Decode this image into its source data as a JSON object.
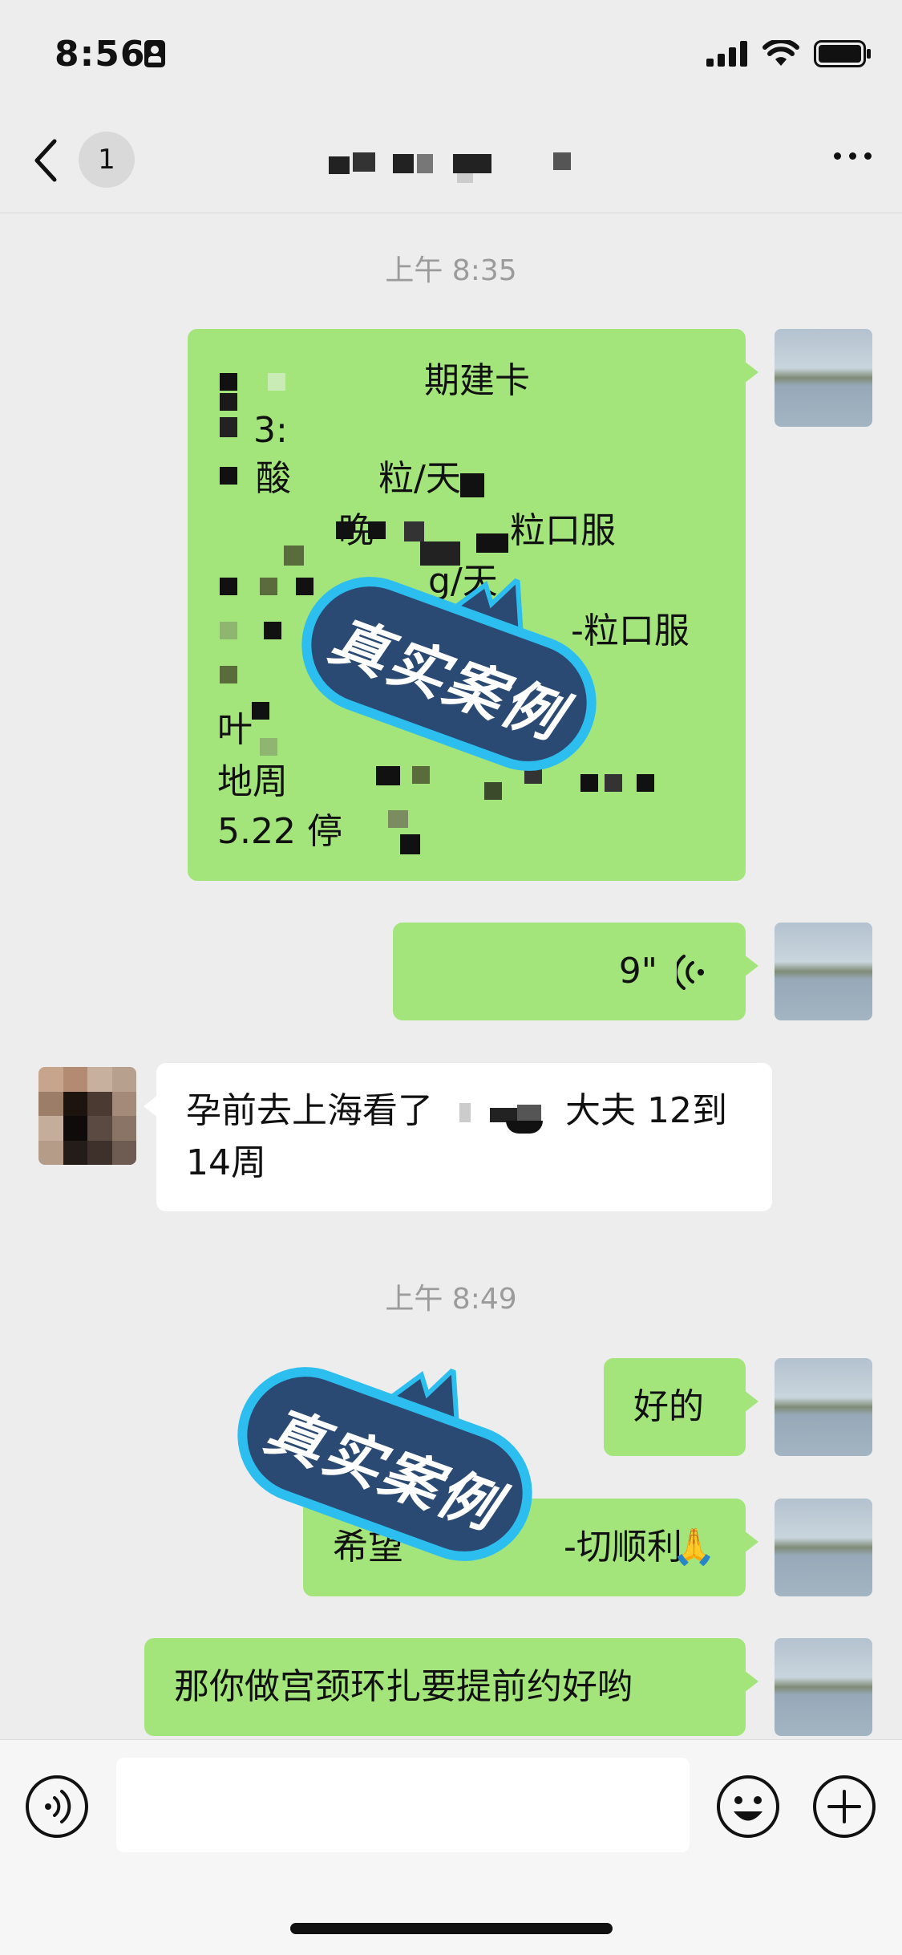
{
  "status_bar": {
    "time": "8:56"
  },
  "nav": {
    "unread_count": "1"
  },
  "timestamps": {
    "first": "上午 8:35",
    "second": "上午 8:49"
  },
  "messages": {
    "m1_lines": [
      "期建卡",
      "3:",
      "酸",
      "粒/天",
      "晚",
      "粒口服",
      "g/天",
      "-粒口服",
      "叶",
      "地周",
      "5.22 停"
    ],
    "m2_duration": "9\"",
    "m3_text_a": "孕前去上海看了",
    "m3_text_b": "大夫 12到",
    "m3_text_c": "14周",
    "m4_text": "好的",
    "m5_text_a": "希望",
    "m5_text_b": "-切顺利",
    "m5_emoji": "🙏",
    "m6_text": "那你做宫颈环扎要提前约好哟"
  },
  "stamp": {
    "text": "真实案例"
  },
  "colors": {
    "my_bubble": "#a4e57b",
    "their_bubble": "#ffffff",
    "background": "#ededed",
    "stamp_fill": "#2a4a73",
    "stamp_border": "#2dbef0"
  }
}
